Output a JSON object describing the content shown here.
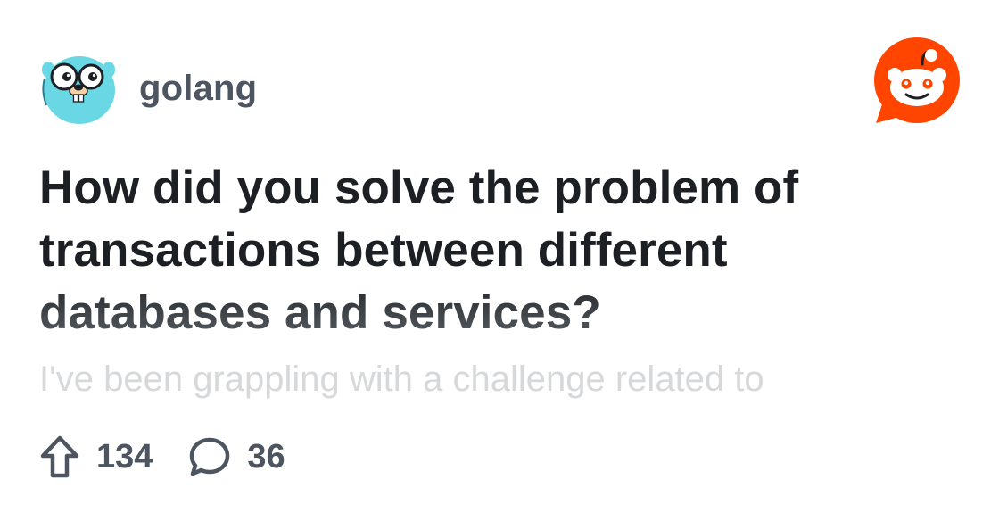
{
  "post": {
    "subreddit": "golang",
    "title": "How did you solve the problem of transactions between different databases and services?",
    "body_preview": "I've been grappling with a challenge related to",
    "upvotes": "134",
    "comments": "36"
  },
  "icons": {
    "subreddit_avatar": "gopher-icon",
    "brand_logo": "reddit-logo-icon",
    "upvote": "upvote-arrow-icon",
    "comment": "comment-bubble-icon"
  },
  "colors": {
    "reddit_orange": "#ff4500",
    "gopher_blue": "#6ad7e5",
    "text_dark": "#1c1f23",
    "text_muted": "#4c5560",
    "text_faded": "#d6d8da"
  }
}
